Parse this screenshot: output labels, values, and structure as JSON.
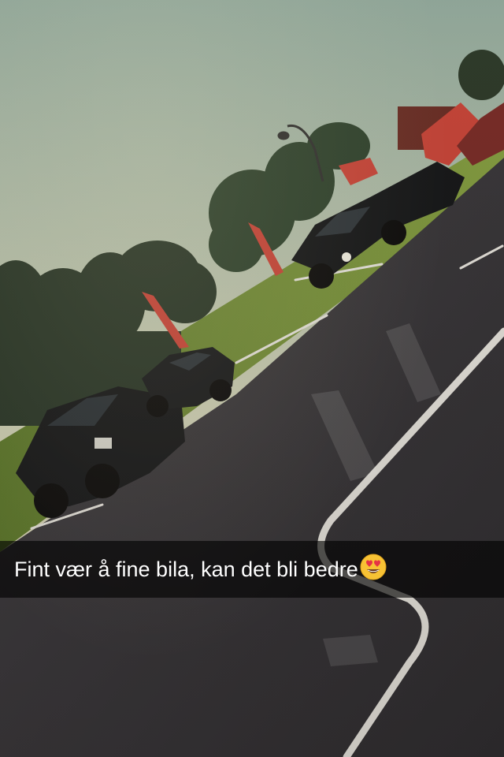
{
  "caption": {
    "text": "Fint vær å fine bila, kan det bli bedre",
    "emoji": "heart-eyes-emoji"
  },
  "colors": {
    "sky_top": "#9fb5a8",
    "sky_bottom": "#e6e0c6",
    "asphalt": "#3b3a3d",
    "grass": "#6d8a3a",
    "trees": "#2b3b2a",
    "tent": "#c8423a",
    "caption_bar": "#000000"
  }
}
